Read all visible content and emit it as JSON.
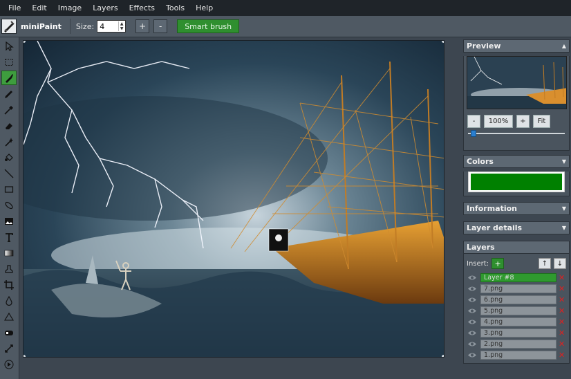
{
  "menu": [
    "File",
    "Edit",
    "Image",
    "Layers",
    "Effects",
    "Tools",
    "Help"
  ],
  "app": {
    "name": "miniPaint"
  },
  "toolbar": {
    "size_label": "Size:",
    "size_value": "4",
    "plus_label": "+",
    "minus_label": "-",
    "smart_brush_label": "Smart brush"
  },
  "tools": [
    {
      "name": "select-tool-icon",
      "active": false
    },
    {
      "name": "selection-rectangle-icon",
      "active": false
    },
    {
      "name": "brush-icon",
      "active": true
    },
    {
      "name": "pencil-icon",
      "active": false
    },
    {
      "name": "pipette-icon",
      "active": false
    },
    {
      "name": "eraser-icon",
      "active": false
    },
    {
      "name": "magic-wand-icon",
      "active": false
    },
    {
      "name": "fill-icon",
      "active": false
    },
    {
      "name": "line-icon",
      "active": false
    },
    {
      "name": "rectangle-icon",
      "active": false
    },
    {
      "name": "ellipse-icon",
      "active": false
    },
    {
      "name": "image-icon",
      "active": false
    },
    {
      "name": "text-icon",
      "active": false
    },
    {
      "name": "gradient-icon",
      "active": false
    },
    {
      "name": "clone-icon",
      "active": false
    },
    {
      "name": "crop-icon",
      "active": false
    },
    {
      "name": "blur-icon",
      "active": false
    },
    {
      "name": "sharpen-icon",
      "active": false
    },
    {
      "name": "desaturate-icon",
      "active": false
    },
    {
      "name": "bulge-icon",
      "active": false
    },
    {
      "name": "animation-icon",
      "active": false
    }
  ],
  "preview": {
    "title": "Preview",
    "zoom_minus": "-",
    "zoom_value": "100%",
    "zoom_plus": "+",
    "fit_label": "Fit",
    "zoom_level": 0.03
  },
  "colors": {
    "title": "Colors",
    "current": "#008000"
  },
  "information": {
    "title": "Information"
  },
  "layer_details": {
    "title": "Layer details"
  },
  "layers": {
    "title": "Layers",
    "insert_label": "Insert:",
    "insert_plus": "+",
    "up_label": "↑",
    "down_label": "↓",
    "items": [
      {
        "name": "Layer #8",
        "active": true
      },
      {
        "name": "7.png",
        "active": false
      },
      {
        "name": "6.png",
        "active": false
      },
      {
        "name": "5.png",
        "active": false
      },
      {
        "name": "4.png",
        "active": false
      },
      {
        "name": "3.png",
        "active": false
      },
      {
        "name": "2.png",
        "active": false
      },
      {
        "name": "1.png",
        "active": false
      }
    ],
    "delete_glyph": "✕"
  }
}
